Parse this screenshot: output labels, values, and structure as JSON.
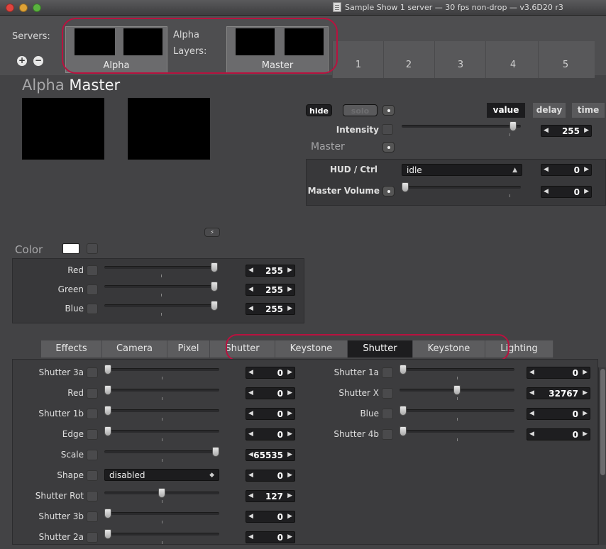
{
  "window": {
    "title": "Sample Show 1 server  —  30 fps non-drop  —  v3.6D20 r3"
  },
  "top": {
    "servers_label": "Servers:",
    "layers_label_1": "Alpha",
    "layers_label_2": "Layers:",
    "server_thumb_caption": "Alpha",
    "layer_thumb_caption": "Master",
    "add_icon": "plus-icon",
    "remove_icon": "minus-icon",
    "columns": [
      "1",
      "2",
      "3",
      "4",
      "5"
    ]
  },
  "heading": {
    "server": "Alpha",
    "layer": "Master"
  },
  "controls": {
    "hide": "hide",
    "solo": "solo",
    "modes": [
      "value",
      "delay",
      "time"
    ],
    "intensity_label": "Intensity",
    "intensity_value": "255",
    "intensity_level": 0.96,
    "master_label": "Master",
    "hud_label": "HUD / Ctrl",
    "hud_value": "idle",
    "hud_step": "0",
    "volume_label": "Master Volume",
    "volume_value": "0",
    "volume_level": 0.0
  },
  "color": {
    "label": "Color",
    "swatch": "#ffffff",
    "rows": [
      {
        "label": "Red",
        "value": "255",
        "level": 1.0
      },
      {
        "label": "Green",
        "value": "255",
        "level": 1.0
      },
      {
        "label": "Blue",
        "value": "255",
        "level": 1.0
      }
    ]
  },
  "tabs": [
    "Effects",
    "Camera",
    "Pixel",
    "Shutter",
    "Keystone",
    "Shutter",
    "Keystone",
    "Lighting"
  ],
  "active_tab_index": 5,
  "left_params": [
    {
      "label": "Shutter 3a",
      "value": "0",
      "level": 0.0
    },
    {
      "label": "Red",
      "value": "0",
      "level": 0.0
    },
    {
      "label": "Shutter 1b",
      "value": "0",
      "level": 0.0
    },
    {
      "label": "Edge",
      "value": "0",
      "level": 0.0
    },
    {
      "label": "Scale",
      "value": "65535",
      "level": 1.0
    },
    {
      "label": "Shape",
      "value": "0",
      "dropdown": "disabled"
    },
    {
      "label": "Shutter Rot",
      "value": "127",
      "level": 0.5
    },
    {
      "label": "Shutter 3b",
      "value": "0",
      "level": 0.0
    },
    {
      "label": "Shutter 2a",
      "value": "0",
      "level": 0.0
    }
  ],
  "right_params": [
    {
      "label": "Shutter 1a",
      "value": "0",
      "level": 0.0
    },
    {
      "label": "Shutter X",
      "value": "32767",
      "level": 0.5
    },
    {
      "label": "Blue",
      "value": "0",
      "level": 0.0
    },
    {
      "label": "Shutter 4b",
      "value": "0",
      "level": 0.0
    }
  ],
  "colors": {
    "highlight": "#b8123f",
    "close": "#e0443e",
    "minimize": "#dea236",
    "zoom": "#5ab33f"
  }
}
